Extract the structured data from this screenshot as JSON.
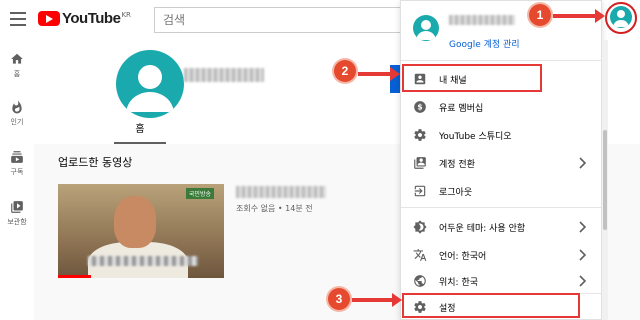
{
  "header": {
    "logo_text": "YouTube",
    "region": "KR",
    "search_placeholder": "검색"
  },
  "leftnav": [
    {
      "label": "홈",
      "icon": "home-icon"
    },
    {
      "label": "인기",
      "icon": "fire-icon"
    },
    {
      "label": "구독",
      "icon": "subscriptions-icon"
    },
    {
      "label": "보관함",
      "icon": "library-icon"
    }
  ],
  "channel": {
    "tab_home": "홈",
    "section_title": "업로드한 동영상",
    "video": {
      "meta": "조회수 없음 • 14분 전",
      "thumb_logo": "국민방송",
      "progress": 0.2
    }
  },
  "account_menu": {
    "manage_account": "Google 계정 관리",
    "items": [
      {
        "label": "내 채널",
        "icon": "account-box-icon",
        "chevron": false
      },
      {
        "label": "유료 멤버십",
        "icon": "dollar-circle-icon",
        "chevron": false
      },
      {
        "label": "YouTube 스튜디오",
        "icon": "gear-icon",
        "chevron": false
      },
      {
        "label": "계정 전환",
        "icon": "switch-account-icon",
        "chevron": true
      },
      {
        "label": "로그아웃",
        "icon": "logout-icon",
        "chevron": false
      },
      {
        "label": "어두운 테마: 사용 안함",
        "icon": "dark-theme-icon",
        "chevron": true
      },
      {
        "label": "언어: 한국어",
        "icon": "translate-icon",
        "chevron": true
      },
      {
        "label": "위치: 한국",
        "icon": "globe-icon",
        "chevron": true
      },
      {
        "label": "설정",
        "icon": "gear-icon",
        "chevron": false
      }
    ]
  },
  "annotations": {
    "steps": [
      "1",
      "2",
      "3"
    ]
  },
  "colors": {
    "brand_red": "#ff0000",
    "link_blue": "#065fd4",
    "avatar_teal": "#1aa9ac",
    "annotation_red": "#e53935"
  }
}
